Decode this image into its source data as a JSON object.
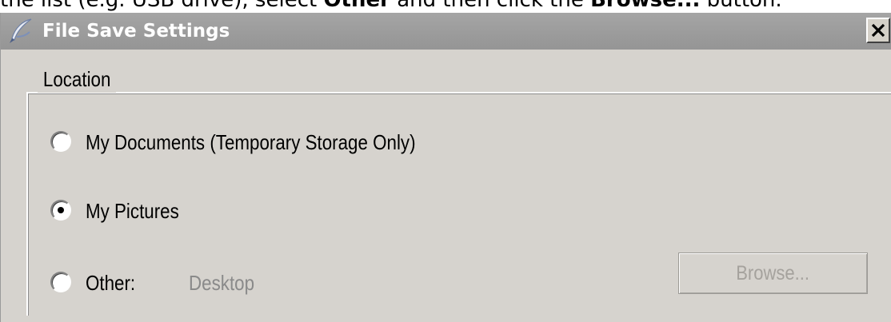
{
  "caption": {
    "prefix": "the list (e.g. USB drive), select ",
    "bold1": "Other",
    "middle": " and then click the ",
    "bold2": "Browse...",
    "suffix": " button."
  },
  "dialog": {
    "title": "File Save Settings",
    "app_icon": "feather-quill-icon",
    "close_icon": "close-x-icon"
  },
  "location_group": {
    "legend": "Location",
    "options": [
      {
        "label": "My Documents (Temporary Storage Only)",
        "selected": false
      },
      {
        "label": "My Pictures",
        "selected": true
      },
      {
        "label": "Other:",
        "selected": false
      }
    ],
    "other_value": "Desktop",
    "browse_label": "Browse...",
    "browse_enabled": false
  },
  "colors": {
    "dialog_bg": "#d6d3ce",
    "titlebar": "#9e9e9e",
    "title_text": "#ffffff",
    "disabled_text": "#8a8a8a"
  }
}
